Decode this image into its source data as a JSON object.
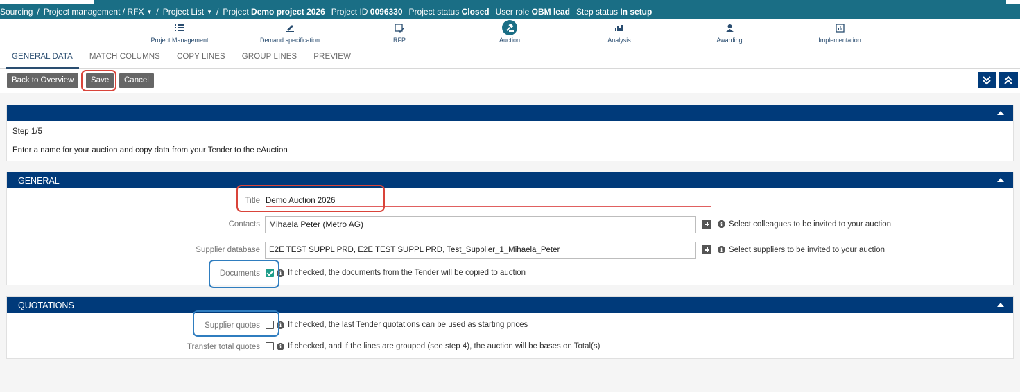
{
  "breadcrumb": {
    "sourcing": "Sourcing",
    "project_management": "Project management / RFX",
    "project_list": "Project List",
    "project_label": "Project",
    "project_name": "Demo project 2026",
    "project_id_label": "Project ID",
    "project_id": "0096330",
    "project_status_label": "Project status",
    "project_status": "Closed",
    "user_role_label": "User role",
    "user_role": "OBM lead",
    "step_status_label": "Step status",
    "step_status": "In setup"
  },
  "stepper": [
    {
      "label": "Project Management",
      "icon": "list-icon"
    },
    {
      "label": "Demand specification",
      "icon": "pen-icon"
    },
    {
      "label": "RFP",
      "icon": "document-check-icon"
    },
    {
      "label": "Auction",
      "icon": "gavel-icon",
      "active": true
    },
    {
      "label": "Analysis",
      "icon": "bar-chart-icon"
    },
    {
      "label": "Awarding",
      "icon": "award-icon"
    },
    {
      "label": "Implementation",
      "icon": "chart-board-icon"
    }
  ],
  "tabs": [
    "GENERAL DATA",
    "MATCH COLUMNS",
    "COPY LINES",
    "GROUP LINES",
    "PREVIEW"
  ],
  "toolbar": {
    "back_label": "Back to Overview",
    "save_label": "Save",
    "cancel_label": "Cancel"
  },
  "intro": {
    "step": "Step 1/5",
    "text": "Enter a name for your auction and copy data from your Tender to the eAuction"
  },
  "general": {
    "header": "GENERAL",
    "title_label": "Title",
    "title_value": "Demo Auction 2026",
    "contacts_label": "Contacts",
    "contacts_value": "Mihaela Peter (Metro AG)",
    "contacts_hint": "Select colleagues to be invited to your auction",
    "supplier_db_label": "Supplier database",
    "supplier_db_value": "E2E TEST SUPPL PRD, E2E TEST SUPPL PRD, Test_Supplier_1_Mihaela_Peter",
    "supplier_db_hint": "Select suppliers to be invited to your auction",
    "documents_label": "Documents",
    "documents_checked": true,
    "documents_hint": "If checked, the documents from the Tender will be copied to auction"
  },
  "quotations": {
    "header": "QUOTATIONS",
    "supplier_quotes_label": "Supplier quotes",
    "supplier_quotes_checked": false,
    "supplier_quotes_hint": "If checked, the last Tender quotations can be used as starting prices",
    "transfer_label": "Transfer total quotes",
    "transfer_checked": false,
    "transfer_hint": "If checked, and if the lines are grouped (see step 4), the auction will be bases on Total(s)"
  },
  "colors": {
    "header_teal": "#1a6e85",
    "panel_navy": "#003a7a",
    "button_gray": "#666666",
    "highlight_red": "#d9443a",
    "highlight_blue": "#2f7dbf",
    "check_green": "#1f9d8a"
  }
}
